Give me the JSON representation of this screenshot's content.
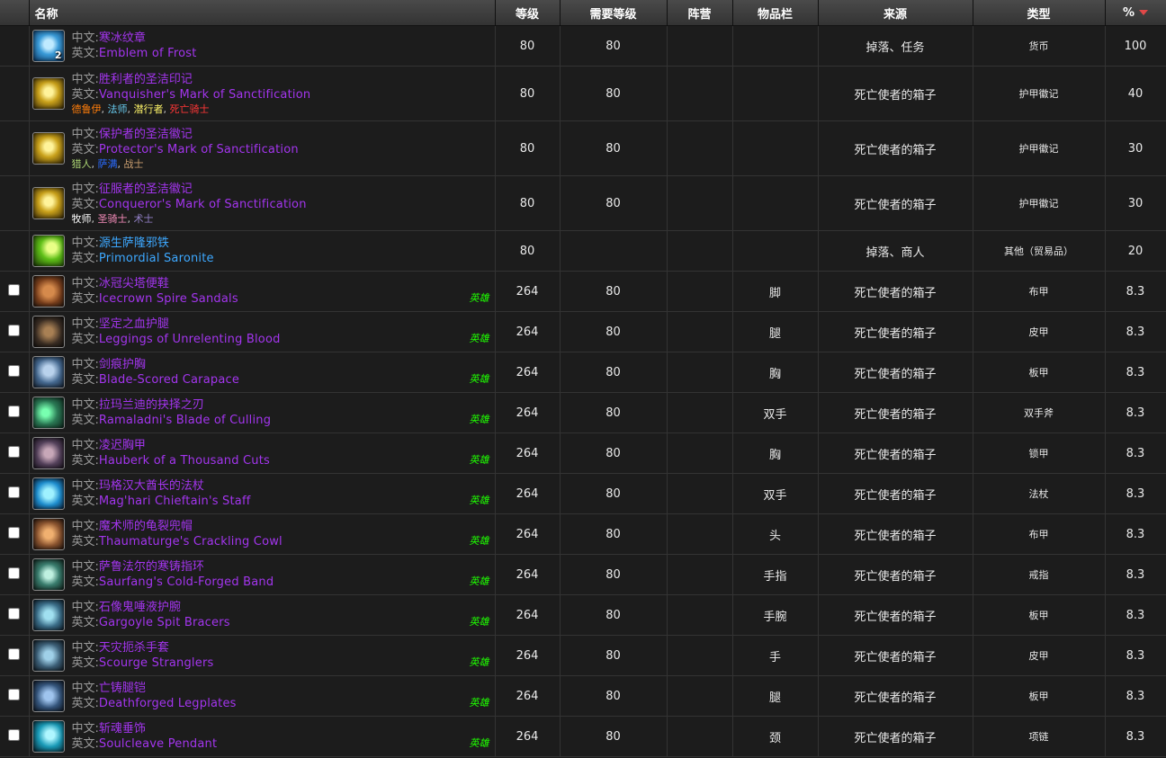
{
  "header": {
    "name": "名称",
    "level": "等级",
    "req_level": "需要等级",
    "faction": "阵营",
    "slot": "物品栏",
    "source": "来源",
    "type": "类型",
    "pct": "%"
  },
  "labels": {
    "cn": "中文:",
    "en": "英文:"
  },
  "colors": {
    "epic": "#a335ee",
    "rare": "#3da8ff",
    "heroic": "#1eff00",
    "sort_arrow": "#e04848"
  },
  "rows": [
    {
      "icon": "emblem-of-frost-icon",
      "count": "2",
      "cn": "寒冰纹章",
      "en": "Emblem of Frost",
      "level": "80",
      "req": "80",
      "faction": "",
      "slot": "",
      "source": "掉落、任务",
      "type": "货币",
      "pct": "100"
    },
    {
      "icon": "mark-of-sanctification-icon",
      "cn": "胜利者的圣洁印记",
      "en": "Vanquisher's Mark of Sanctification",
      "classes": [
        "德鲁伊",
        "法师",
        "潜行者",
        "死亡骑士"
      ],
      "level": "80",
      "req": "80",
      "faction": "",
      "slot": "",
      "source": "死亡使者的箱子",
      "type": "护甲徽记",
      "pct": "40"
    },
    {
      "icon": "mark-of-sanctification-icon",
      "cn": "保护者的圣洁徽记",
      "en": "Protector's Mark of Sanctification",
      "classes": [
        "猎人",
        "萨满",
        "战士"
      ],
      "level": "80",
      "req": "80",
      "faction": "",
      "slot": "",
      "source": "死亡使者的箱子",
      "type": "护甲徽记",
      "pct": "30"
    },
    {
      "icon": "mark-of-sanctification-icon",
      "cn": "征服者的圣洁徽记",
      "en": "Conqueror's Mark of Sanctification",
      "classes": [
        "牧师",
        "圣骑士",
        "术士"
      ],
      "level": "80",
      "req": "80",
      "faction": "",
      "slot": "",
      "source": "死亡使者的箱子",
      "type": "护甲徽记",
      "pct": "30"
    },
    {
      "icon": "primordial-saronite-icon",
      "cn": "源生萨隆邪铁",
      "en": "Primordial Saronite",
      "level": "80",
      "req": "",
      "faction": "",
      "slot": "",
      "source": "掉落、商人",
      "type": "其他（贸易品）",
      "pct": "20"
    },
    {
      "icon": "sandals-icon",
      "cn": "冰冠尖塔便鞋",
      "en": "Icecrown Spire Sandals",
      "heroic": "英雄",
      "level": "264",
      "req": "80",
      "faction": "",
      "slot": "脚",
      "source": "死亡使者的箱子",
      "type": "布甲",
      "pct": "8.3"
    },
    {
      "icon": "leggings-icon",
      "cn": "坚定之血护腿",
      "en": "Leggings of Unrelenting Blood",
      "heroic": "英雄",
      "level": "264",
      "req": "80",
      "faction": "",
      "slot": "腿",
      "source": "死亡使者的箱子",
      "type": "皮甲",
      "pct": "8.3"
    },
    {
      "icon": "carapace-icon",
      "cn": "剑痕护胸",
      "en": "Blade-Scored Carapace",
      "heroic": "英雄",
      "level": "264",
      "req": "80",
      "faction": "",
      "slot": "胸",
      "source": "死亡使者的箱子",
      "type": "板甲",
      "pct": "8.3"
    },
    {
      "icon": "axe-icon",
      "cn": "拉玛兰迪的抉择之刃",
      "en": "Ramaladni's Blade of Culling",
      "heroic": "英雄",
      "level": "264",
      "req": "80",
      "faction": "",
      "slot": "双手",
      "source": "死亡使者的箱子",
      "type": "双手斧",
      "pct": "8.3"
    },
    {
      "icon": "hauberk-icon",
      "cn": "凌迟胸甲",
      "en": "Hauberk of a Thousand Cuts",
      "heroic": "英雄",
      "level": "264",
      "req": "80",
      "faction": "",
      "slot": "胸",
      "source": "死亡使者的箱子",
      "type": "锁甲",
      "pct": "8.3"
    },
    {
      "icon": "staff-icon",
      "cn": "玛格汉大酋长的法杖",
      "en": "Mag'hari Chieftain's Staff",
      "heroic": "英雄",
      "level": "264",
      "req": "80",
      "faction": "",
      "slot": "双手",
      "source": "死亡使者的箱子",
      "type": "法杖",
      "pct": "8.3"
    },
    {
      "icon": "cowl-icon",
      "cn": "魔术师的龟裂兜帽",
      "en": "Thaumaturge's Crackling Cowl",
      "heroic": "英雄",
      "level": "264",
      "req": "80",
      "faction": "",
      "slot": "头",
      "source": "死亡使者的箱子",
      "type": "布甲",
      "pct": "8.3"
    },
    {
      "icon": "ring-icon",
      "cn": "萨鲁法尔的寒铸指环",
      "en": "Saurfang's Cold-Forged Band",
      "heroic": "英雄",
      "level": "264",
      "req": "80",
      "faction": "",
      "slot": "手指",
      "source": "死亡使者的箱子",
      "type": "戒指",
      "pct": "8.3"
    },
    {
      "icon": "bracers-icon",
      "cn": "石像鬼唾液护腕",
      "en": "Gargoyle Spit Bracers",
      "heroic": "英雄",
      "level": "264",
      "req": "80",
      "faction": "",
      "slot": "手腕",
      "source": "死亡使者的箱子",
      "type": "板甲",
      "pct": "8.3"
    },
    {
      "icon": "gloves-icon",
      "cn": "天灾扼杀手套",
      "en": "Scourge Stranglers",
      "heroic": "英雄",
      "level": "264",
      "req": "80",
      "faction": "",
      "slot": "手",
      "source": "死亡使者的箱子",
      "type": "皮甲",
      "pct": "8.3"
    },
    {
      "icon": "legplates-icon",
      "cn": "亡铸腿铠",
      "en": "Deathforged Legplates",
      "heroic": "英雄",
      "level": "264",
      "req": "80",
      "faction": "",
      "slot": "腿",
      "source": "死亡使者的箱子",
      "type": "板甲",
      "pct": "8.3"
    },
    {
      "icon": "pendant-icon",
      "cn": "斩魂垂饰",
      "en": "Soulcleave Pendant",
      "heroic": "英雄",
      "level": "264",
      "req": "80",
      "faction": "",
      "slot": "颈",
      "source": "死亡使者的箱子",
      "type": "项链",
      "pct": "8.3"
    }
  ]
}
